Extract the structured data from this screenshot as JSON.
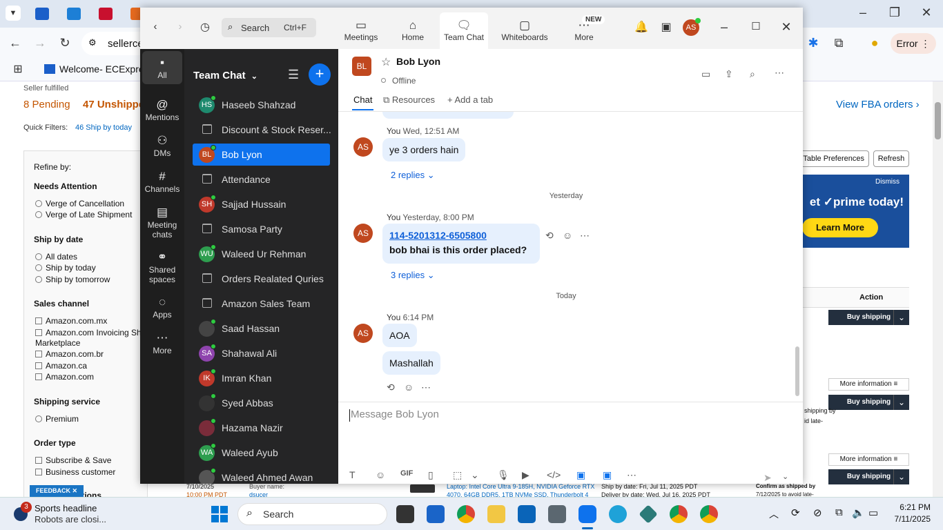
{
  "browser": {
    "address_partial": "sellerce",
    "bookmark": "Welcome- ECExpres...",
    "error_label": "Error"
  },
  "bg": {
    "seller_fulfilled": "Seller fulfilled",
    "pending": "8 Pending",
    "unshipped": "47 Unshipped",
    "quick_filters": "Quick Filters:",
    "ship_today_filter": "46 Ship by today",
    "view_fba": "View FBA orders ›",
    "table_prefs": "t Table Preferences",
    "refresh": "Refresh",
    "dismiss": "Dismiss",
    "prime_text": "et ✓prime today!",
    "learn_more": "Learn More",
    "refine_by": "Refine by:",
    "needs_attention": "Needs Attention",
    "verge_cancel": "Verge of Cancellation",
    "verge_late": "Verge of Late Shipment",
    "ship_by_date": "Ship by date",
    "all_dates": "All dates",
    "ship_by_today": "Ship by today",
    "ship_by_tomorrow": "Ship by tomorrow",
    "sales_channel": "Sales channel",
    "ch1": "Amazon.com.mx",
    "ch2a": "Amazon.com Invoicing Shado",
    "ch2b": "Marketplace",
    "ch3": "Amazon.com.br",
    "ch4": "Amazon.ca",
    "ch5": "Amazon.com",
    "shipping_service": "Shipping service",
    "premium": "Premium",
    "order_type": "Order type",
    "subscribe": "Subscribe & Save",
    "business": "Business customer",
    "actions": "ng actions",
    "feedback": "FEEDBACK ✕",
    "action_col": "Action",
    "buy_shipping": "Buy shipping",
    "more_info": "More information ≡",
    "row_date": "7/10/2025",
    "row_time": "10:00 PM PDT",
    "buyer_name": "Buyer name:",
    "buyer": "dsucer",
    "product": "Laptop: Intel Core Ultra 9-185H, NVIDIA Geforce RTX",
    "product2": "4070, 64GB DDR5, 1TB NVMe SSD, Thunderbolt 4",
    "ship_by": "Ship by date: Fri, Jul 11, 2025 PDT",
    "deliver_by": "Deliver by date: Wed, Jul 16, 2025 PDT",
    "confirm_ship": "Confirm as shipped by",
    "confirm_date": "7/12/2025 to avoid late-",
    "shipping_by": "shipping by",
    "avoid_late": "id late-"
  },
  "zoom": {
    "search": "Search",
    "shortcut": "Ctrl+F",
    "nav": [
      {
        "label": "Meetings",
        "icon": "video"
      },
      {
        "label": "Home",
        "icon": "home"
      },
      {
        "label": "Team Chat",
        "icon": "chat"
      },
      {
        "label": "Whiteboards",
        "icon": "whiteboard"
      },
      {
        "label": "More",
        "icon": "more"
      }
    ],
    "new_badge": "NEW",
    "user_initials": "AS",
    "rail": [
      "All",
      "Mentions",
      "DMs",
      "Channels",
      "Meeting chats",
      "Shared spaces",
      "Apps",
      "More"
    ],
    "list_title": "Team Chat",
    "contacts": [
      {
        "name": "Haseeb Shahzad",
        "type": "avatar",
        "initials": "HS",
        "color": "#1e8a6e"
      },
      {
        "name": "Discount & Stock Reser...",
        "type": "lock"
      },
      {
        "name": "Bob Lyon",
        "type": "avatar",
        "initials": "BL",
        "color": "#c0481f"
      },
      {
        "name": "Attendance",
        "type": "lock"
      },
      {
        "name": "Sajjad Hussain",
        "type": "avatar",
        "initials": "SH",
        "color": "#c0392b"
      },
      {
        "name": "Samosa Party",
        "type": "lock"
      },
      {
        "name": "Waleed Ur Rehman",
        "type": "avatar",
        "initials": "WU",
        "color": "#2e9e4f"
      },
      {
        "name": "Orders Realated Quries",
        "type": "lock"
      },
      {
        "name": "Amazon Sales Team",
        "type": "lock"
      },
      {
        "name": "Saad Hassan",
        "type": "photo",
        "initials": "",
        "color": "#444"
      },
      {
        "name": "Shahawal Ali",
        "type": "avatar",
        "initials": "SA",
        "color": "#8e44ad"
      },
      {
        "name": "Imran Khan",
        "type": "avatar",
        "initials": "IK",
        "color": "#c0392b"
      },
      {
        "name": "Syed Abbas",
        "type": "photo",
        "initials": "",
        "color": "#333"
      },
      {
        "name": "Hazama Nazir",
        "type": "photo",
        "initials": "",
        "color": "#7a2c3a"
      },
      {
        "name": "Waleed Ayub",
        "type": "avatar",
        "initials": "WA",
        "color": "#2e9e4f"
      },
      {
        "name": "Waleed Ahmed Awan",
        "type": "photo",
        "initials": "",
        "color": "#555"
      }
    ],
    "chat": {
      "name": "Bob Lyon",
      "initials": "BL",
      "status": "Offline",
      "tabs": [
        "Chat",
        "Resources",
        "Add a tab"
      ],
      "messages": [
        {
          "sender": "You",
          "time": "Wed, 12:51 AM",
          "text": "ye 3 orders hain",
          "replies": "2 replies"
        },
        {
          "day": "Yesterday"
        },
        {
          "sender": "You",
          "time": "Yesterday, 8:00 PM",
          "link": "114-5201312-6505800",
          "text": "bob bhai is this order placed?",
          "replies": "3 replies"
        },
        {
          "day": "Today"
        },
        {
          "sender": "You",
          "time": "6:14 PM",
          "text": "AOA",
          "text2": "Mashallah"
        }
      ],
      "composer_placeholder": "Message Bob Lyon",
      "composer_tools": [
        "text-format",
        "emoji",
        "GIF",
        "file",
        "screenshot",
        "chevron",
        "audio",
        "video-message",
        "code",
        "app1",
        "app2",
        "more"
      ]
    }
  },
  "taskbar": {
    "badge": "3",
    "news_title": "Sports headline",
    "news_sub": "Robots are closi...",
    "search": "Search",
    "time": "6:21 PM",
    "date": "7/11/2025"
  }
}
